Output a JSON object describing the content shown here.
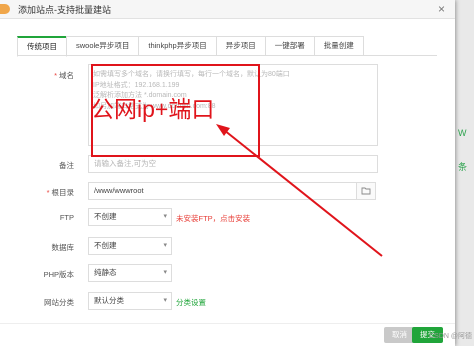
{
  "window": {
    "title": "添加站点-支持批量建站"
  },
  "tabs": [
    {
      "label": "传统项目",
      "active": true
    },
    {
      "label": "swoole异步项目"
    },
    {
      "label": "thinkphp异步项目"
    },
    {
      "label": "异步项目"
    },
    {
      "label": "一键部署"
    },
    {
      "label": "批量创建"
    }
  ],
  "form": {
    "domain": {
      "label": "域名",
      "placeholder_lines": [
        "如需填写多个域名，请换行填写，每行一个域名，默认为80端口",
        "IP地址格式：192.168.1.199",
        "泛解析添加方法 *.domain.com",
        "如另加端口格式为 www.domain.com:88"
      ]
    },
    "remark": {
      "label": "备注",
      "placeholder": "请输入备注,可为空"
    },
    "root": {
      "label": "根目录",
      "value": "/www/wwwroot"
    },
    "ftp": {
      "label": "FTP",
      "value": "不创建",
      "note": "未安装FTP，点击安装"
    },
    "database": {
      "label": "数据库",
      "value": "不创建"
    },
    "php": {
      "label": "PHP版本",
      "value": "纯静态"
    },
    "category": {
      "label": "网站分类",
      "value": "默认分类",
      "link": "分类设置"
    }
  },
  "annotation": {
    "text": "公网ip+端口",
    "color": "#e0141b"
  },
  "footer": {
    "cancel": "取消",
    "submit": "提交",
    "watermark": "CSDN @阿德"
  },
  "background": {
    "mark1": "W",
    "mark2": "条"
  },
  "colors": {
    "accent": "#20a53a",
    "warning": "#e8403a"
  }
}
